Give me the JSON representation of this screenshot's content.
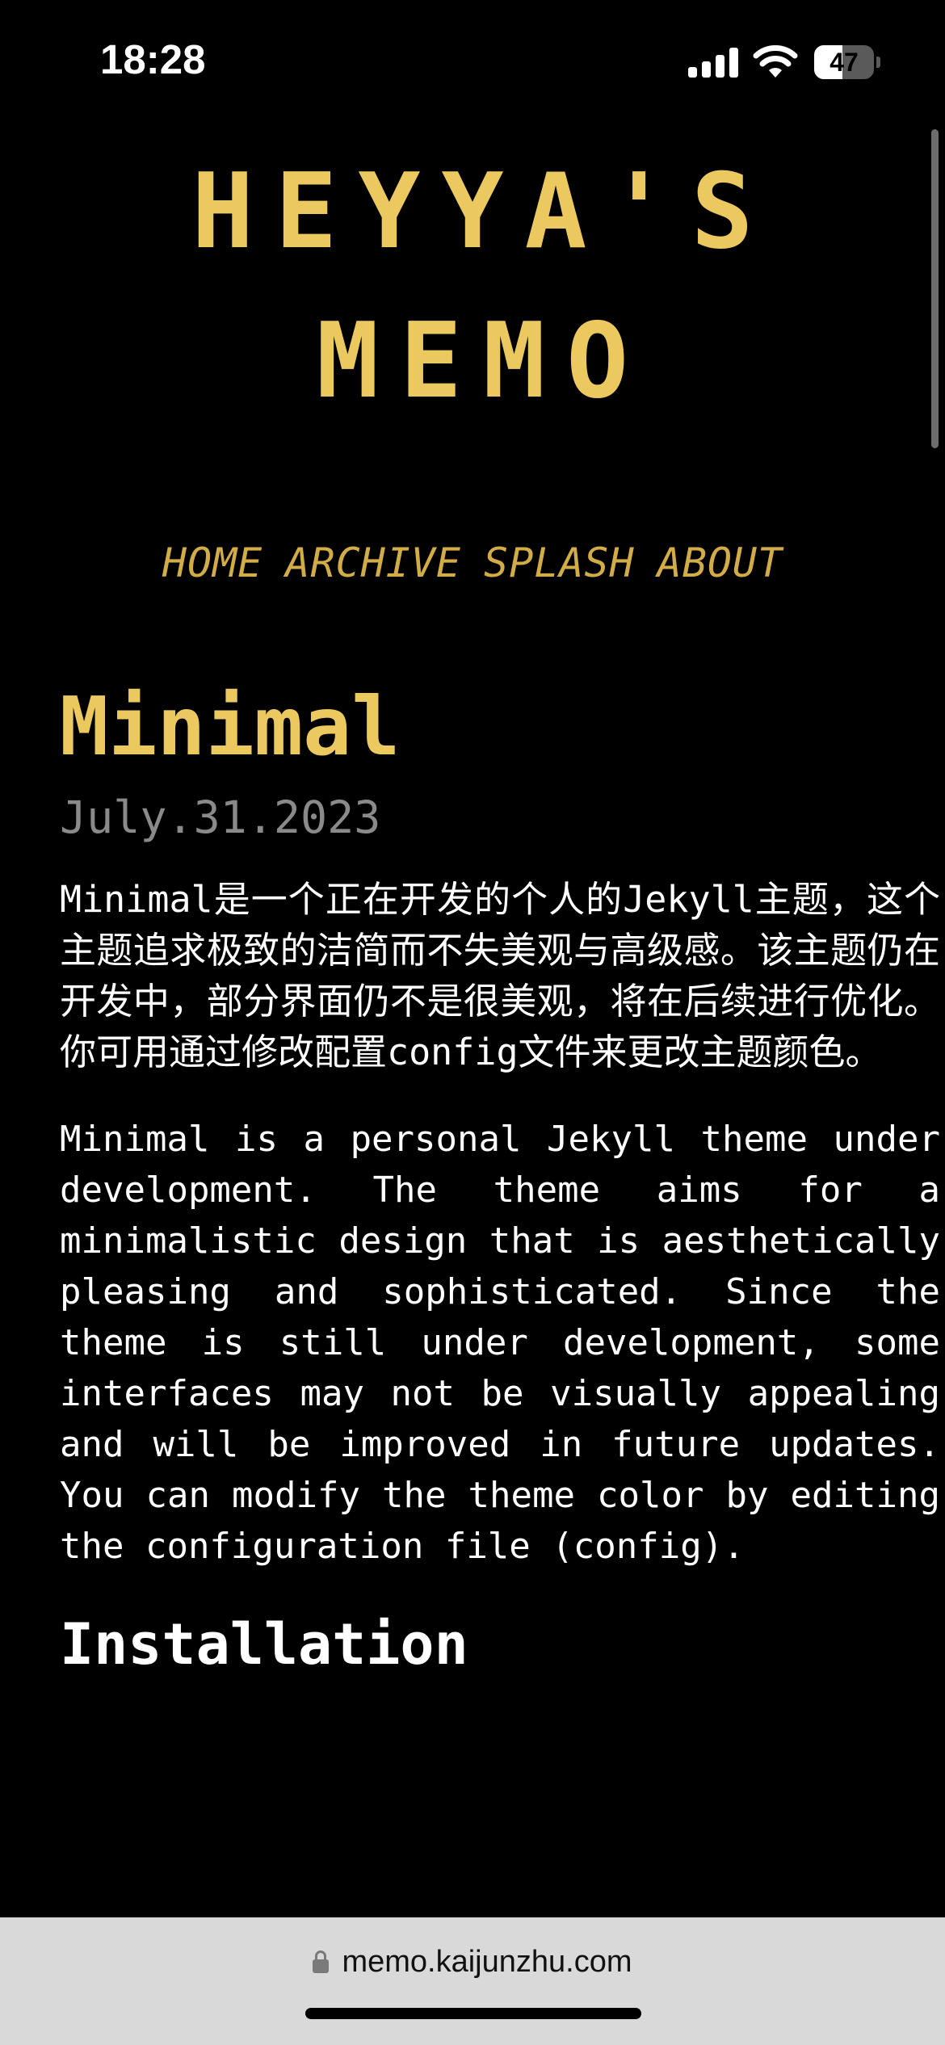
{
  "status_bar": {
    "time": "18:28",
    "battery_level": "47",
    "battery_fraction": 0.47,
    "icons": [
      "signal-icon",
      "wifi-icon",
      "battery-icon"
    ]
  },
  "header": {
    "title_line1": "HEYYA'S",
    "title_line2": "MEMO",
    "accent_color": "#ecc95f"
  },
  "nav": {
    "items": [
      {
        "label": "HOME"
      },
      {
        "label": "ARCHIVE"
      },
      {
        "label": "SPLASH"
      },
      {
        "label": "ABOUT"
      }
    ]
  },
  "post": {
    "title": "Minimal",
    "date": "July.31.2023",
    "paragraph_zh": "Minimal是一个正在开发的个人的Jekyll主题，这个主题追求极致的洁简而不失美观与高级感。该主题仍在开发中，部分界面仍不是很美观，将在后续进行优化。你可用通过修改配置config文件来更改主题颜色。",
    "paragraph_en": "Minimal is a personal Jekyll theme under development. The theme aims for a minimalistic design that is aesthetically pleasing and sophisticated. Since the theme is still under development, some interfaces may not be visually appealing and will be improved in future updates. You can modify the theme color by editing the configuration file (config).",
    "section_heading": "Installation"
  },
  "browser": {
    "url": "memo.kaijunzhu.com",
    "bar_color": "#d9d9d9"
  }
}
